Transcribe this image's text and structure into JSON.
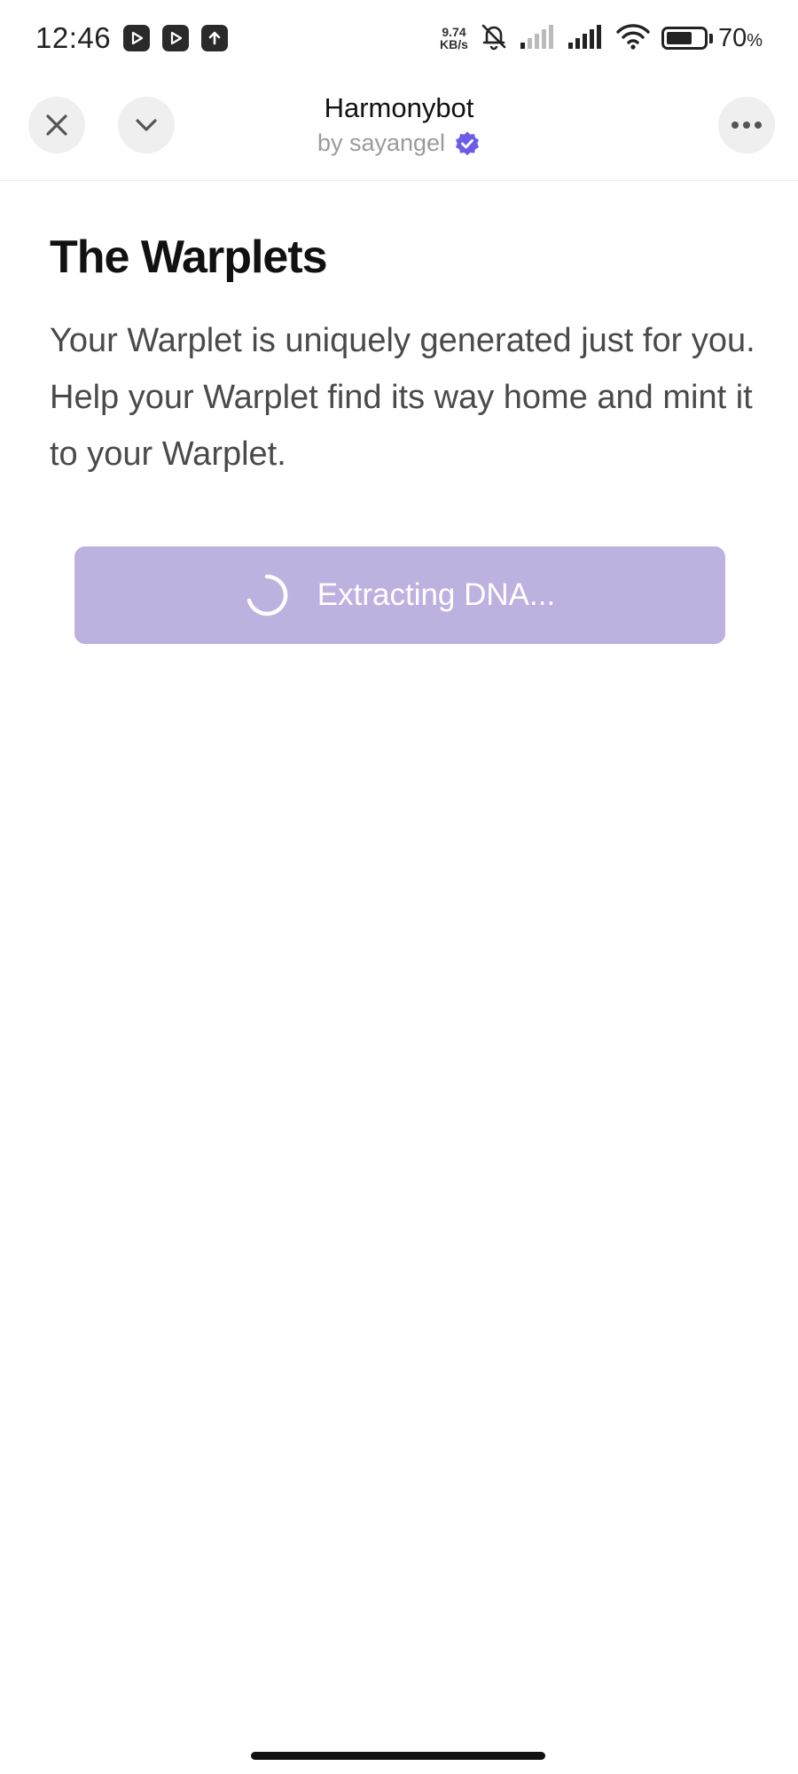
{
  "status_bar": {
    "time": "12:46",
    "net_speed_value": "9.74",
    "net_speed_unit": "KB/s",
    "battery_percent": "70",
    "battery_unit": "%",
    "battery_level": 0.7,
    "icons": [
      "video-app-icon",
      "video-app-icon",
      "upload-icon",
      "bell-muted-icon",
      "signal-icon",
      "signal-icon",
      "wifi-icon",
      "battery-icon"
    ]
  },
  "header": {
    "title": "Harmonybot",
    "subtitle": "by sayangel",
    "verified_color": "#6c5ce7",
    "close_icon": "close-icon",
    "collapse_icon": "chevron-down-icon",
    "more_icon": "more-icon"
  },
  "main": {
    "title": "The Warplets",
    "description": "Your Warplet is uniquely generated just for you. Help your Warplet find its way home and mint it to your Warplet.",
    "action_button": {
      "label": "Extracting DNA...",
      "state": "loading",
      "color": "#bdb1e0"
    }
  }
}
